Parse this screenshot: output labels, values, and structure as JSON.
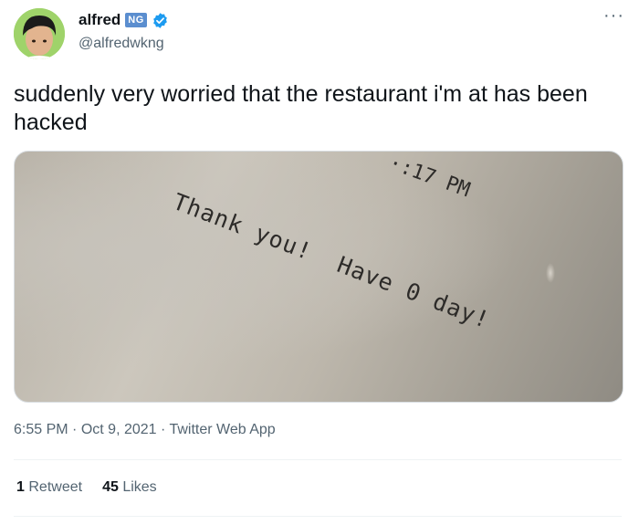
{
  "author": {
    "display_name": "alfred",
    "badge": "NG",
    "handle": "@alfredwkng"
  },
  "menu_icon": "more-horizontal-icon",
  "tweet": {
    "text": "suddenly very worried that the restaurant i'm at has been hacked"
  },
  "photo": {
    "receipt_time": "·:17 PM",
    "receipt_message": "Thank you!  Have 0 day!"
  },
  "meta": {
    "time": "6:55 PM",
    "date": "Oct 9, 2021",
    "source": "Twitter Web App",
    "separator": "·"
  },
  "stats": {
    "retweets_count": "1",
    "retweets_label": "Retweet",
    "likes_count": "45",
    "likes_label": "Likes"
  },
  "colors": {
    "verified": "#1d9bf0",
    "secondary_text": "#536471"
  }
}
